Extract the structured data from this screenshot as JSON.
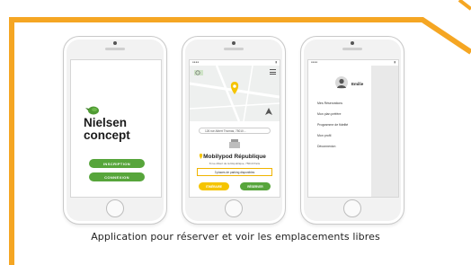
{
  "caption": "Application pour réserver et voir les emplacements libres",
  "colors": {
    "frame": "#f5a623",
    "brand_green": "#57a53b",
    "accent_yellow": "#f5c400"
  },
  "phone1": {
    "brand_line1": "Nielsen",
    "brand_line2": "concept",
    "btn_inscription": "INSCRIPTION",
    "btn_connexion": "CONNEXION"
  },
  "phone2": {
    "address": "126 rue Albert Thomas, 75010...",
    "station_name": "Mobilypod République",
    "station_address": "8 rue Albert de la République, 75010 Paris",
    "places": "3 places de parking disponibles",
    "btn_itineraire": "ITINÉRAIRE",
    "btn_reserver": "RÉSERVER"
  },
  "phone3": {
    "user_name": "Emilie",
    "menu": [
      "Mes Réservations",
      "Mon plan préfère",
      "Programme de fidelité",
      "Mon profil",
      "Déconnexion"
    ]
  }
}
